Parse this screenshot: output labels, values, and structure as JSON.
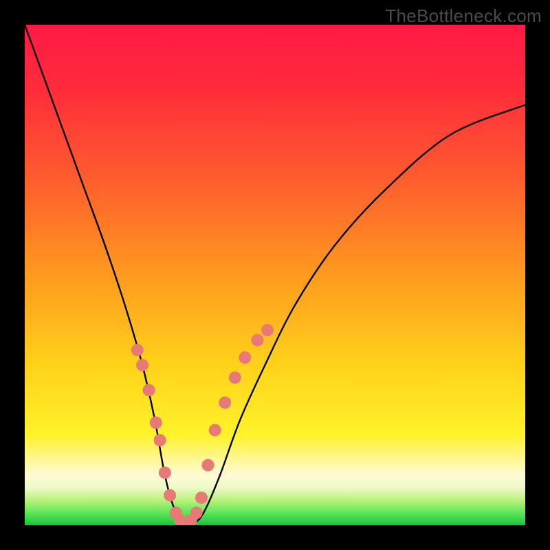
{
  "watermark": "TheBottleneck.com",
  "chart_data": {
    "type": "line",
    "title": "",
    "xlabel": "",
    "ylabel": "",
    "xlim": [
      0,
      100
    ],
    "ylim": [
      0,
      100
    ],
    "series": [
      {
        "name": "curve",
        "x": [
          0,
          4,
          8,
          12,
          16,
          20,
          23.5,
          26,
          28,
          30,
          32,
          34,
          36,
          39,
          43,
          48,
          54,
          62,
          72,
          85,
          100
        ],
        "values": [
          100,
          89,
          78,
          67,
          56,
          44,
          32,
          21,
          10,
          3,
          0.5,
          0.5,
          3,
          10,
          21,
          32,
          44,
          56,
          67,
          78,
          84
        ]
      }
    ],
    "markers_x": [
      22.5,
      23.5,
      24.8,
      26.2,
      27.0,
      28.0,
      29.0,
      30.2,
      31.0,
      32.0,
      33.2,
      34.3,
      35.3,
      36.6,
      38.0,
      40.0,
      42.0,
      44.0,
      46.5,
      48.5
    ],
    "markers_values": [
      35.0,
      32.0,
      27.0,
      20.5,
      17.0,
      10.5,
      6.0,
      2.5,
      1.0,
      0.6,
      1.0,
      2.5,
      5.5,
      12.0,
      19.0,
      24.5,
      29.5,
      33.5,
      37.0,
      39.0
    ],
    "gradient_stops": [
      {
        "offset": 0.0,
        "color": "#ff1a44"
      },
      {
        "offset": 0.12,
        "color": "#ff2a3c"
      },
      {
        "offset": 0.3,
        "color": "#ff5a2e"
      },
      {
        "offset": 0.5,
        "color": "#ff9a1e"
      },
      {
        "offset": 0.68,
        "color": "#ffd21a"
      },
      {
        "offset": 0.82,
        "color": "#fff22a"
      },
      {
        "offset": 0.87,
        "color": "#fff79a"
      },
      {
        "offset": 0.9,
        "color": "#fffad4"
      },
      {
        "offset": 0.925,
        "color": "#eef9c8"
      },
      {
        "offset": 0.95,
        "color": "#b8f27a"
      },
      {
        "offset": 0.975,
        "color": "#5fe65a"
      },
      {
        "offset": 1.0,
        "color": "#17c43e"
      }
    ],
    "marker_color": "#e77a74",
    "curve_color": "#000000",
    "curve_width": 2.4,
    "marker_radius": 9
  }
}
